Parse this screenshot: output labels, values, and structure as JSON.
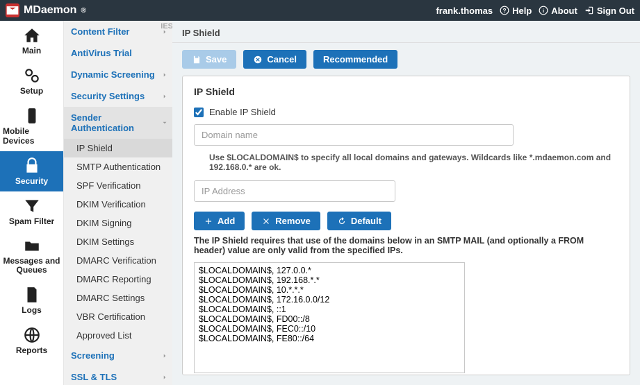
{
  "topbar": {
    "brand": "MDaemon",
    "reg": "®",
    "user": "frank.thomas",
    "help": "Help",
    "about": "About",
    "signout": "Sign Out"
  },
  "iconnav": [
    {
      "label": "Main",
      "active": false
    },
    {
      "label": "Setup",
      "active": false
    },
    {
      "label": "Mobile Devices",
      "active": false
    },
    {
      "label": "Security",
      "active": true
    },
    {
      "label": "Spam Filter",
      "active": false
    },
    {
      "label": "Messages and Queues",
      "active": false
    },
    {
      "label": "Logs",
      "active": false
    },
    {
      "label": "Reports",
      "active": false
    }
  ],
  "sidenav": {
    "top_clip": "IES",
    "items": [
      {
        "label": "Content Filter",
        "type": "section",
        "chev": true
      },
      {
        "label": "AntiVirus Trial",
        "type": "section"
      },
      {
        "label": "Dynamic Screening",
        "type": "section",
        "chev": true
      },
      {
        "label": "Security Settings",
        "type": "section",
        "chev": true
      },
      {
        "label": "Sender Authentication",
        "type": "section",
        "chev": true,
        "open": true,
        "subs": [
          {
            "label": "IP Shield",
            "active": true
          },
          {
            "label": "SMTP Authentication"
          },
          {
            "label": "SPF Verification"
          },
          {
            "label": "DKIM Verification"
          },
          {
            "label": "DKIM Signing"
          },
          {
            "label": "DKIM Settings"
          },
          {
            "label": "DMARC Verification"
          },
          {
            "label": "DMARC Reporting"
          },
          {
            "label": "DMARC Settings"
          },
          {
            "label": "VBR Certification"
          },
          {
            "label": "Approved List"
          }
        ]
      },
      {
        "label": "Screening",
        "type": "section",
        "chev": true
      },
      {
        "label": "SSL & TLS",
        "type": "section",
        "chev": true
      }
    ]
  },
  "crumb": "IP Shield",
  "toolbar": {
    "save": "Save",
    "cancel": "Cancel",
    "recommended": "Recommended"
  },
  "panel": {
    "title": "IP Shield",
    "enable_label": "Enable IP Shield",
    "enable_checked": true,
    "domain_placeholder": "Domain name",
    "hint": "Use $LOCALDOMAIN$ to specify all local domains and gateways. Wildcards like *.mdaemon.com and 192.168.0.* are ok.",
    "ip_placeholder": "IP Address",
    "btn_add": "Add",
    "btn_remove": "Remove",
    "btn_default": "Default",
    "desc": "The IP Shield requires that use of the domains below in an SMTP MAIL (and optionally a FROM header) value are only valid from the specified IPs.",
    "entries": [
      "$LOCALDOMAIN$, 127.0.0.*",
      "$LOCALDOMAIN$, 192.168.*.*",
      "$LOCALDOMAIN$, 10.*.*.*",
      "$LOCALDOMAIN$, 172.16.0.0/12",
      "$LOCALDOMAIN$, ::1",
      "$LOCALDOMAIN$, FD00::/8",
      "$LOCALDOMAIN$, FEC0::/10",
      "$LOCALDOMAIN$, FE80::/64"
    ]
  }
}
